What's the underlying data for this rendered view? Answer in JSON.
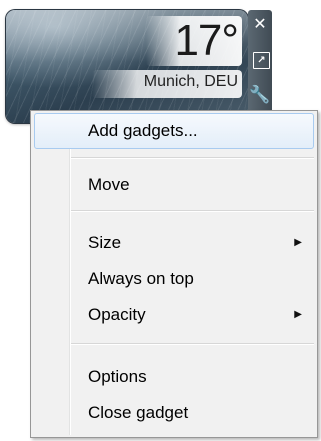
{
  "gadget": {
    "temperature": "17°",
    "location": "Munich, DEU"
  },
  "controls": {
    "close_icon": "close-icon",
    "size_icon": "larger-size-icon",
    "options_icon": "wrench-icon"
  },
  "menu": {
    "items": [
      {
        "label": "Add gadgets..."
      },
      {
        "label": "Move"
      },
      {
        "label": "Size"
      },
      {
        "label": "Always on top"
      },
      {
        "label": "Opacity"
      },
      {
        "label": "Options"
      },
      {
        "label": "Close gadget"
      }
    ]
  },
  "colors": {
    "menu_background": "#f1f1f1",
    "highlight_border": "#a8cbf0",
    "highlight_fill": "#e3eef9"
  }
}
